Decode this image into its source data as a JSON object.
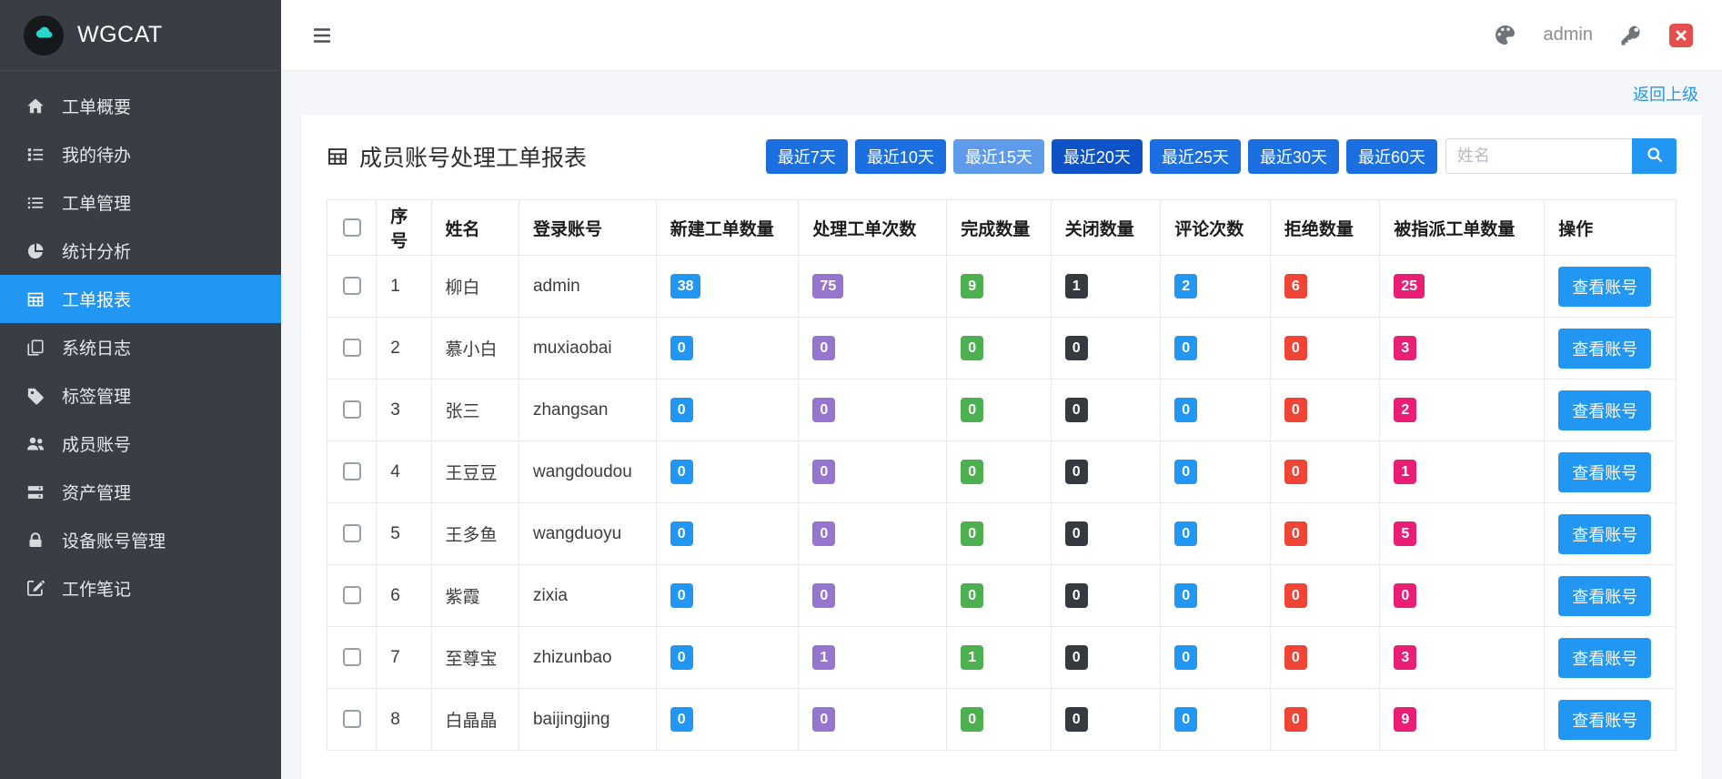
{
  "app": {
    "brand": "WGCAT"
  },
  "topbar": {
    "username": "admin"
  },
  "nav_links": {
    "back_link": "返回上级"
  },
  "sidebar": {
    "items": [
      {
        "key": "work-order-summary",
        "label": "工单概要",
        "icon": "home",
        "active": false
      },
      {
        "key": "my-todo",
        "label": "我的待办",
        "icon": "tasks",
        "active": false
      },
      {
        "key": "work-order-management",
        "label": "工单管理",
        "icon": "list",
        "active": false
      },
      {
        "key": "statistics-analysis",
        "label": "统计分析",
        "icon": "pie-chart",
        "active": false
      },
      {
        "key": "work-order-report",
        "label": "工单报表",
        "icon": "table",
        "active": true
      },
      {
        "key": "system-log",
        "label": "系统日志",
        "icon": "copy",
        "active": false
      },
      {
        "key": "tag-management",
        "label": "标签管理",
        "icon": "tag",
        "active": false
      },
      {
        "key": "member-accounts",
        "label": "成员账号",
        "icon": "users",
        "active": false
      },
      {
        "key": "asset-management",
        "label": "资产管理",
        "icon": "server",
        "active": false
      },
      {
        "key": "device-account-management",
        "label": "设备账号管理",
        "icon": "lock",
        "active": false
      },
      {
        "key": "work-notes",
        "label": "工作笔记",
        "icon": "edit",
        "active": false
      }
    ]
  },
  "report": {
    "title": "成员账号处理工单报表",
    "filters": [
      {
        "key": "last-7-days",
        "label": "最近7天",
        "color": "#1b6fe0",
        "active": false
      },
      {
        "key": "last-10-days",
        "label": "最近10天",
        "color": "#1b6fe0",
        "active": false
      },
      {
        "key": "last-15-days",
        "label": "最近15天",
        "color": "#5e9ceb",
        "active": true
      },
      {
        "key": "last-20-days",
        "label": "最近20天",
        "color": "#0d53c7",
        "active": false
      },
      {
        "key": "last-25-days",
        "label": "最近25天",
        "color": "#1b6fe0",
        "active": false
      },
      {
        "key": "last-30-days",
        "label": "最近30天",
        "color": "#1b6fe0",
        "active": false
      },
      {
        "key": "last-60-days",
        "label": "最近60天",
        "color": "#1b6fe0",
        "active": false
      }
    ],
    "search": {
      "placeholder": "姓名"
    },
    "table": {
      "headers": [
        "序号",
        "姓名",
        "登录账号",
        "新建工单数量",
        "处理工单次数",
        "完成数量",
        "关闭数量",
        "评论次数",
        "拒绝数量",
        "被指派工单数量",
        "操作"
      ],
      "action_label": "查看账号",
      "badge_colors": [
        "#2196f3",
        "#9575cd",
        "#4caf50",
        "#343a40",
        "#2196f3",
        "#ef4436",
        "#e91e74"
      ],
      "rows": [
        {
          "no": 1,
          "name": "柳白",
          "account": "admin",
          "counts": [
            38,
            75,
            9,
            1,
            2,
            6,
            25
          ]
        },
        {
          "no": 2,
          "name": "慕小白",
          "account": "muxiaobai",
          "counts": [
            0,
            0,
            0,
            0,
            0,
            0,
            3
          ]
        },
        {
          "no": 3,
          "name": "张三",
          "account": "zhangsan",
          "counts": [
            0,
            0,
            0,
            0,
            0,
            0,
            2
          ]
        },
        {
          "no": 4,
          "name": "王豆豆",
          "account": "wangdoudou",
          "counts": [
            0,
            0,
            0,
            0,
            0,
            0,
            1
          ]
        },
        {
          "no": 5,
          "name": "王多鱼",
          "account": "wangduoyu",
          "counts": [
            0,
            0,
            0,
            0,
            0,
            0,
            5
          ]
        },
        {
          "no": 6,
          "name": "紫霞",
          "account": "zixia",
          "counts": [
            0,
            0,
            0,
            0,
            0,
            0,
            0
          ]
        },
        {
          "no": 7,
          "name": "至尊宝",
          "account": "zhizunbao",
          "counts": [
            0,
            1,
            1,
            0,
            0,
            0,
            3
          ]
        },
        {
          "no": 8,
          "name": "白晶晶",
          "account": "baijingjing",
          "counts": [
            0,
            0,
            0,
            0,
            0,
            0,
            9
          ]
        }
      ]
    }
  },
  "colors": {
    "accent_blue": "#2196f3",
    "sidebar_bg": "#383e44",
    "logo_teal": "#2ad5c9",
    "logout_red": "#e5504f"
  }
}
